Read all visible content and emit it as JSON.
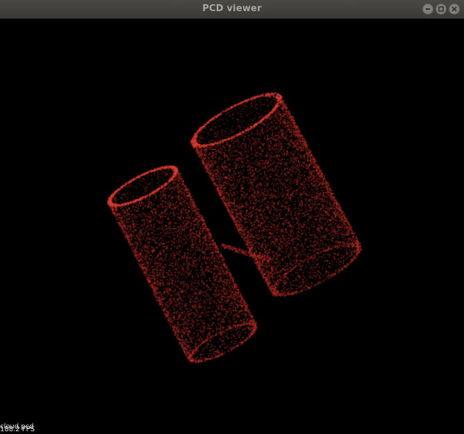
{
  "window": {
    "title": "PCD viewer",
    "controls": [
      "minimize",
      "maximize",
      "close"
    ]
  },
  "viewport": {
    "background": "#000000",
    "point_color": "#c83228",
    "overlay": {
      "file_label": "cloud.pcd",
      "fps_label": "188.2 FPS"
    }
  }
}
